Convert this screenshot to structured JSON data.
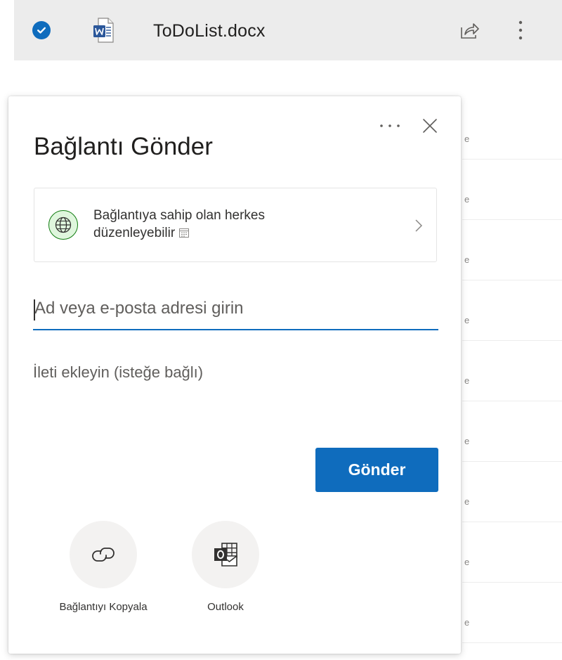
{
  "file": {
    "name": "ToDoList.docx",
    "icons": [
      "check-circle-icon",
      "word-document-icon",
      "share-icon",
      "more-vertical-icon"
    ]
  },
  "background_list": {
    "visible_chars": [
      "e",
      "e",
      "e",
      "e",
      "e",
      "e",
      "e",
      "e",
      "e"
    ]
  },
  "dialog": {
    "title": "Bağlantı Gönder",
    "permission": {
      "line1": "Bağlantıya sahip olan herkes",
      "line2": "düzenleyebilir"
    },
    "recipient_placeholder": "Ad veya e-posta adresi girin",
    "message_placeholder": "İleti ekleyin (isteğe bağlı)",
    "send_label": "Gönder",
    "options": [
      {
        "label": "Bağlantıyı Kopyala",
        "icon": "link-icon"
      },
      {
        "label": "Outlook",
        "icon": "outlook-icon"
      }
    ]
  },
  "colors": {
    "accent": "#0f6cbd",
    "globe_fill": "#dff6dd",
    "globe_stroke": "#107c10",
    "header_bg": "#ececec"
  }
}
